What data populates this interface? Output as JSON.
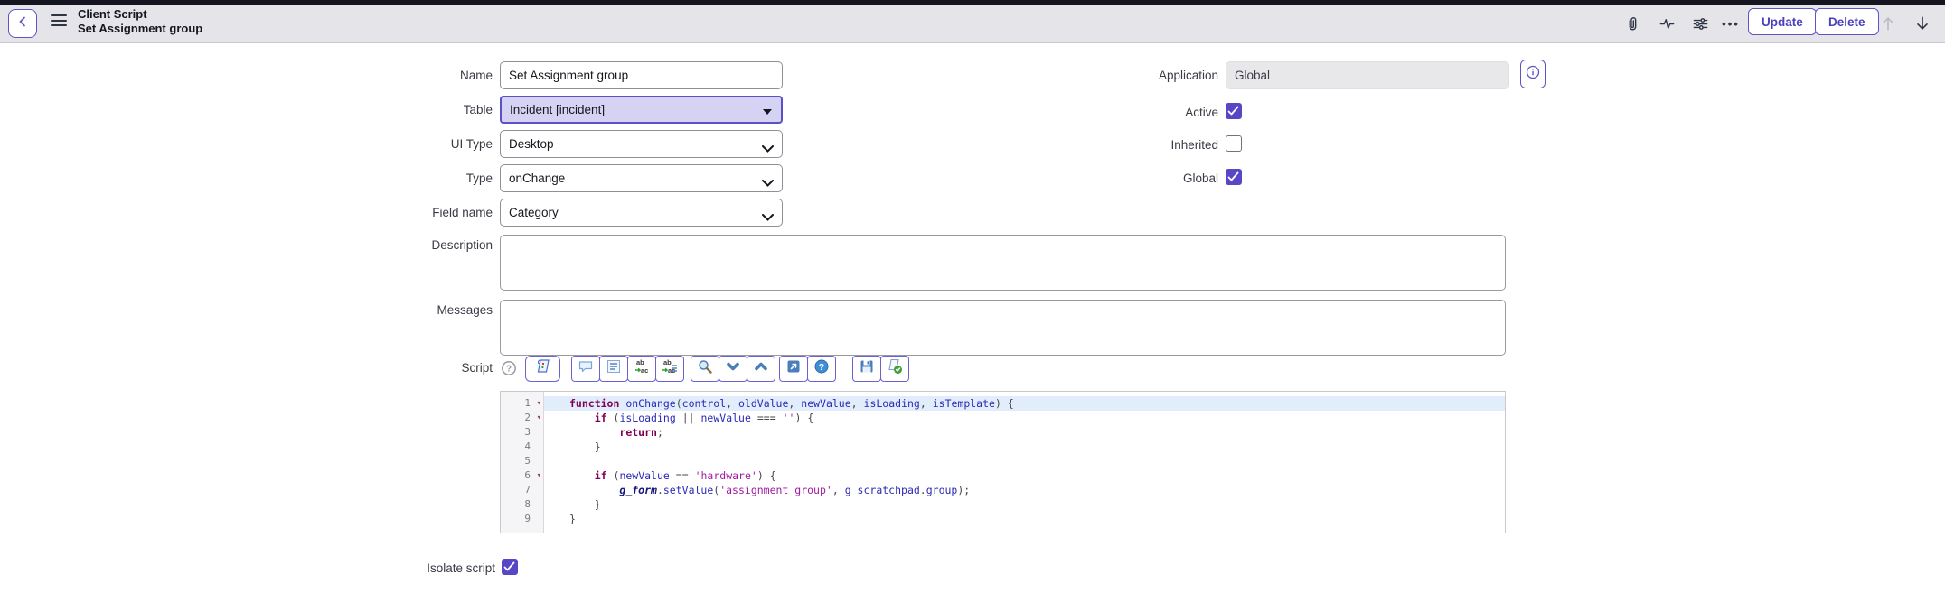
{
  "header": {
    "title": "Client Script",
    "subtitle": "Set Assignment group",
    "icons": [
      "back-icon",
      "menu-icon",
      "paperclip-icon",
      "activity-icon",
      "sliders-icon",
      "more-icon",
      "arrow-up-icon",
      "arrow-down-icon"
    ],
    "actions": {
      "update": "Update",
      "delete": "Delete"
    }
  },
  "form": {
    "name": {
      "label": "Name",
      "value": "Set Assignment group"
    },
    "table": {
      "label": "Table",
      "value": "Incident [incident]"
    },
    "ui_type": {
      "label": "UI Type",
      "value": "Desktop"
    },
    "type": {
      "label": "Type",
      "value": "onChange"
    },
    "field_name": {
      "label": "Field name",
      "value": "Category"
    },
    "application": {
      "label": "Application",
      "value": "Global"
    },
    "active": {
      "label": "Active",
      "checked": true
    },
    "inherited": {
      "label": "Inherited",
      "checked": false
    },
    "global": {
      "label": "Global",
      "checked": true
    },
    "description": {
      "label": "Description",
      "value": ""
    },
    "messages": {
      "label": "Messages",
      "value": ""
    },
    "script": {
      "label": "Script"
    },
    "isolate_script": {
      "label": "Isolate script",
      "checked": true
    }
  },
  "script_toolbar": {
    "icons": [
      "help-outline-icon",
      "edit-script-icon",
      "toggle-comment-icon",
      "format-code-icon",
      "replace-icon",
      "replace-all-icon",
      "search-icon",
      "find-next-icon",
      "find-previous-icon",
      "open-in-new-window-icon",
      "api-help-icon",
      "save-icon",
      "check-syntax-icon"
    ]
  },
  "script_editor": {
    "active_line": 1,
    "fold_lines": [
      1,
      2,
      6
    ],
    "lines": [
      "function onChange(control, oldValue, newValue, isLoading, isTemplate) {",
      "    if (isLoading || newValue === '') {",
      "        return;",
      "    }",
      "",
      "    if (newValue == 'hardware') {",
      "        g_form.setValue('assignment_group', g_scratchpad.group);",
      "    }",
      "}"
    ]
  },
  "colors": {
    "accent": "#5e54c8",
    "accent_text": "#4a41bd",
    "checkbox": "#5747c6",
    "active_line_bg": "#e1edfa",
    "keyword": "#7f0055",
    "identifier": "#2a2ab8",
    "string": "#a11aa1"
  }
}
